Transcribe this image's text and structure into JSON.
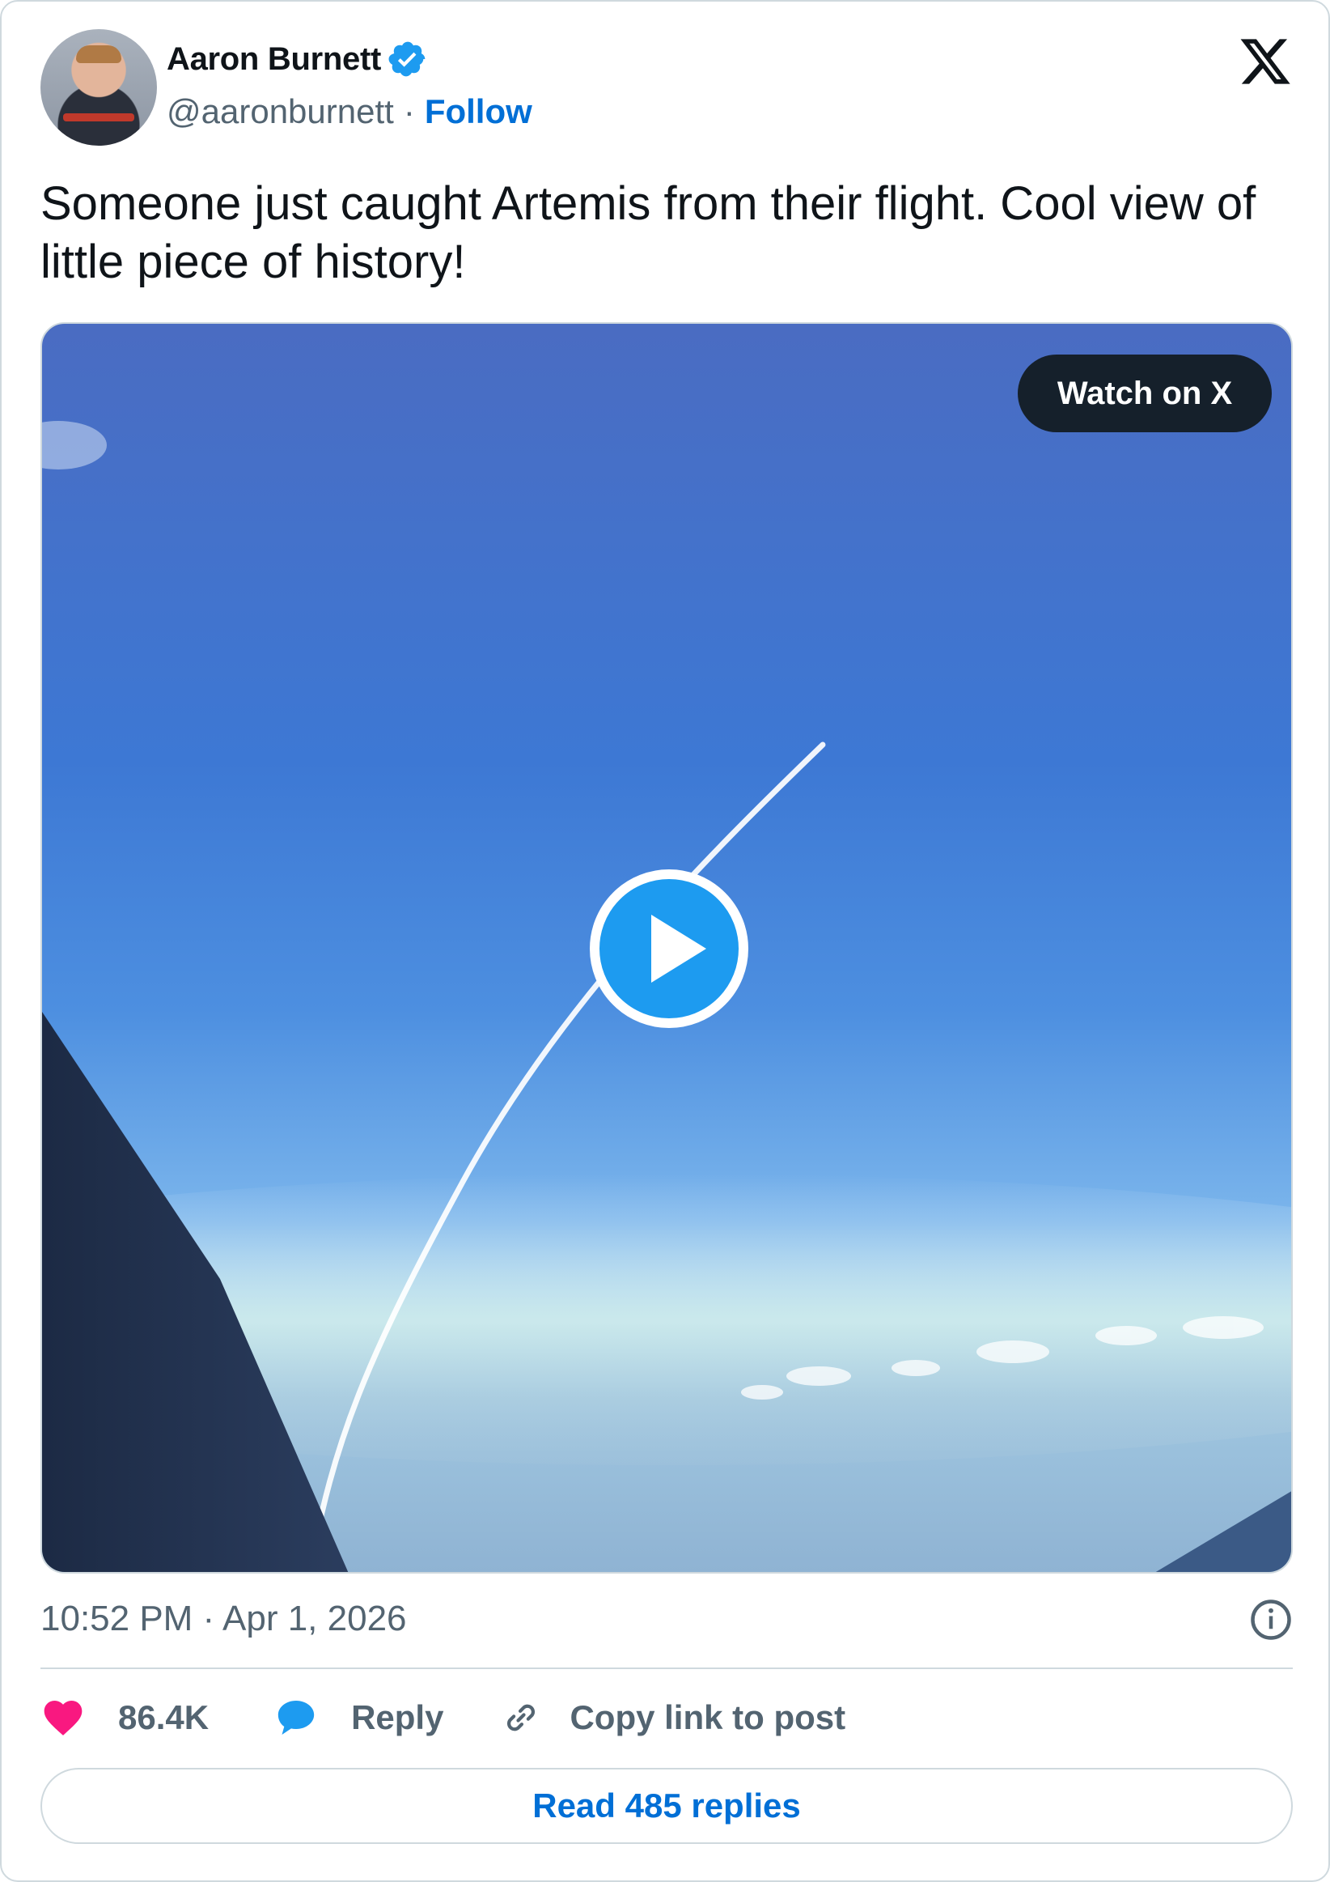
{
  "author": {
    "name": "Aaron Burnett",
    "handle": "@aaronburnett",
    "separator": "·",
    "follow_label": "Follow"
  },
  "tweet": {
    "text": "Someone just caught Artemis from their flight. Cool view of little piece of history!",
    "timestamp": "10:52 PM · Apr 1, 2026"
  },
  "media": {
    "watch_label": "Watch on X"
  },
  "actions": {
    "likes": "86.4K",
    "reply_label": "Reply",
    "copy_label": "Copy link to post"
  },
  "footer": {
    "read_replies_label": "Read 485 replies"
  },
  "icons": {
    "verified": "verified-badge-icon",
    "logo": "x-logo-icon",
    "play": "play-icon",
    "info": "info-icon",
    "like": "heart-icon",
    "reply": "speech-bubble-icon",
    "copy": "link-icon"
  },
  "colors": {
    "link_blue": "#006fd6",
    "verified_blue": "#1d9bf0",
    "like_pink": "#f91880",
    "muted_text": "#536471",
    "border": "#cfd9de",
    "watch_button_bg": "#15202b"
  }
}
